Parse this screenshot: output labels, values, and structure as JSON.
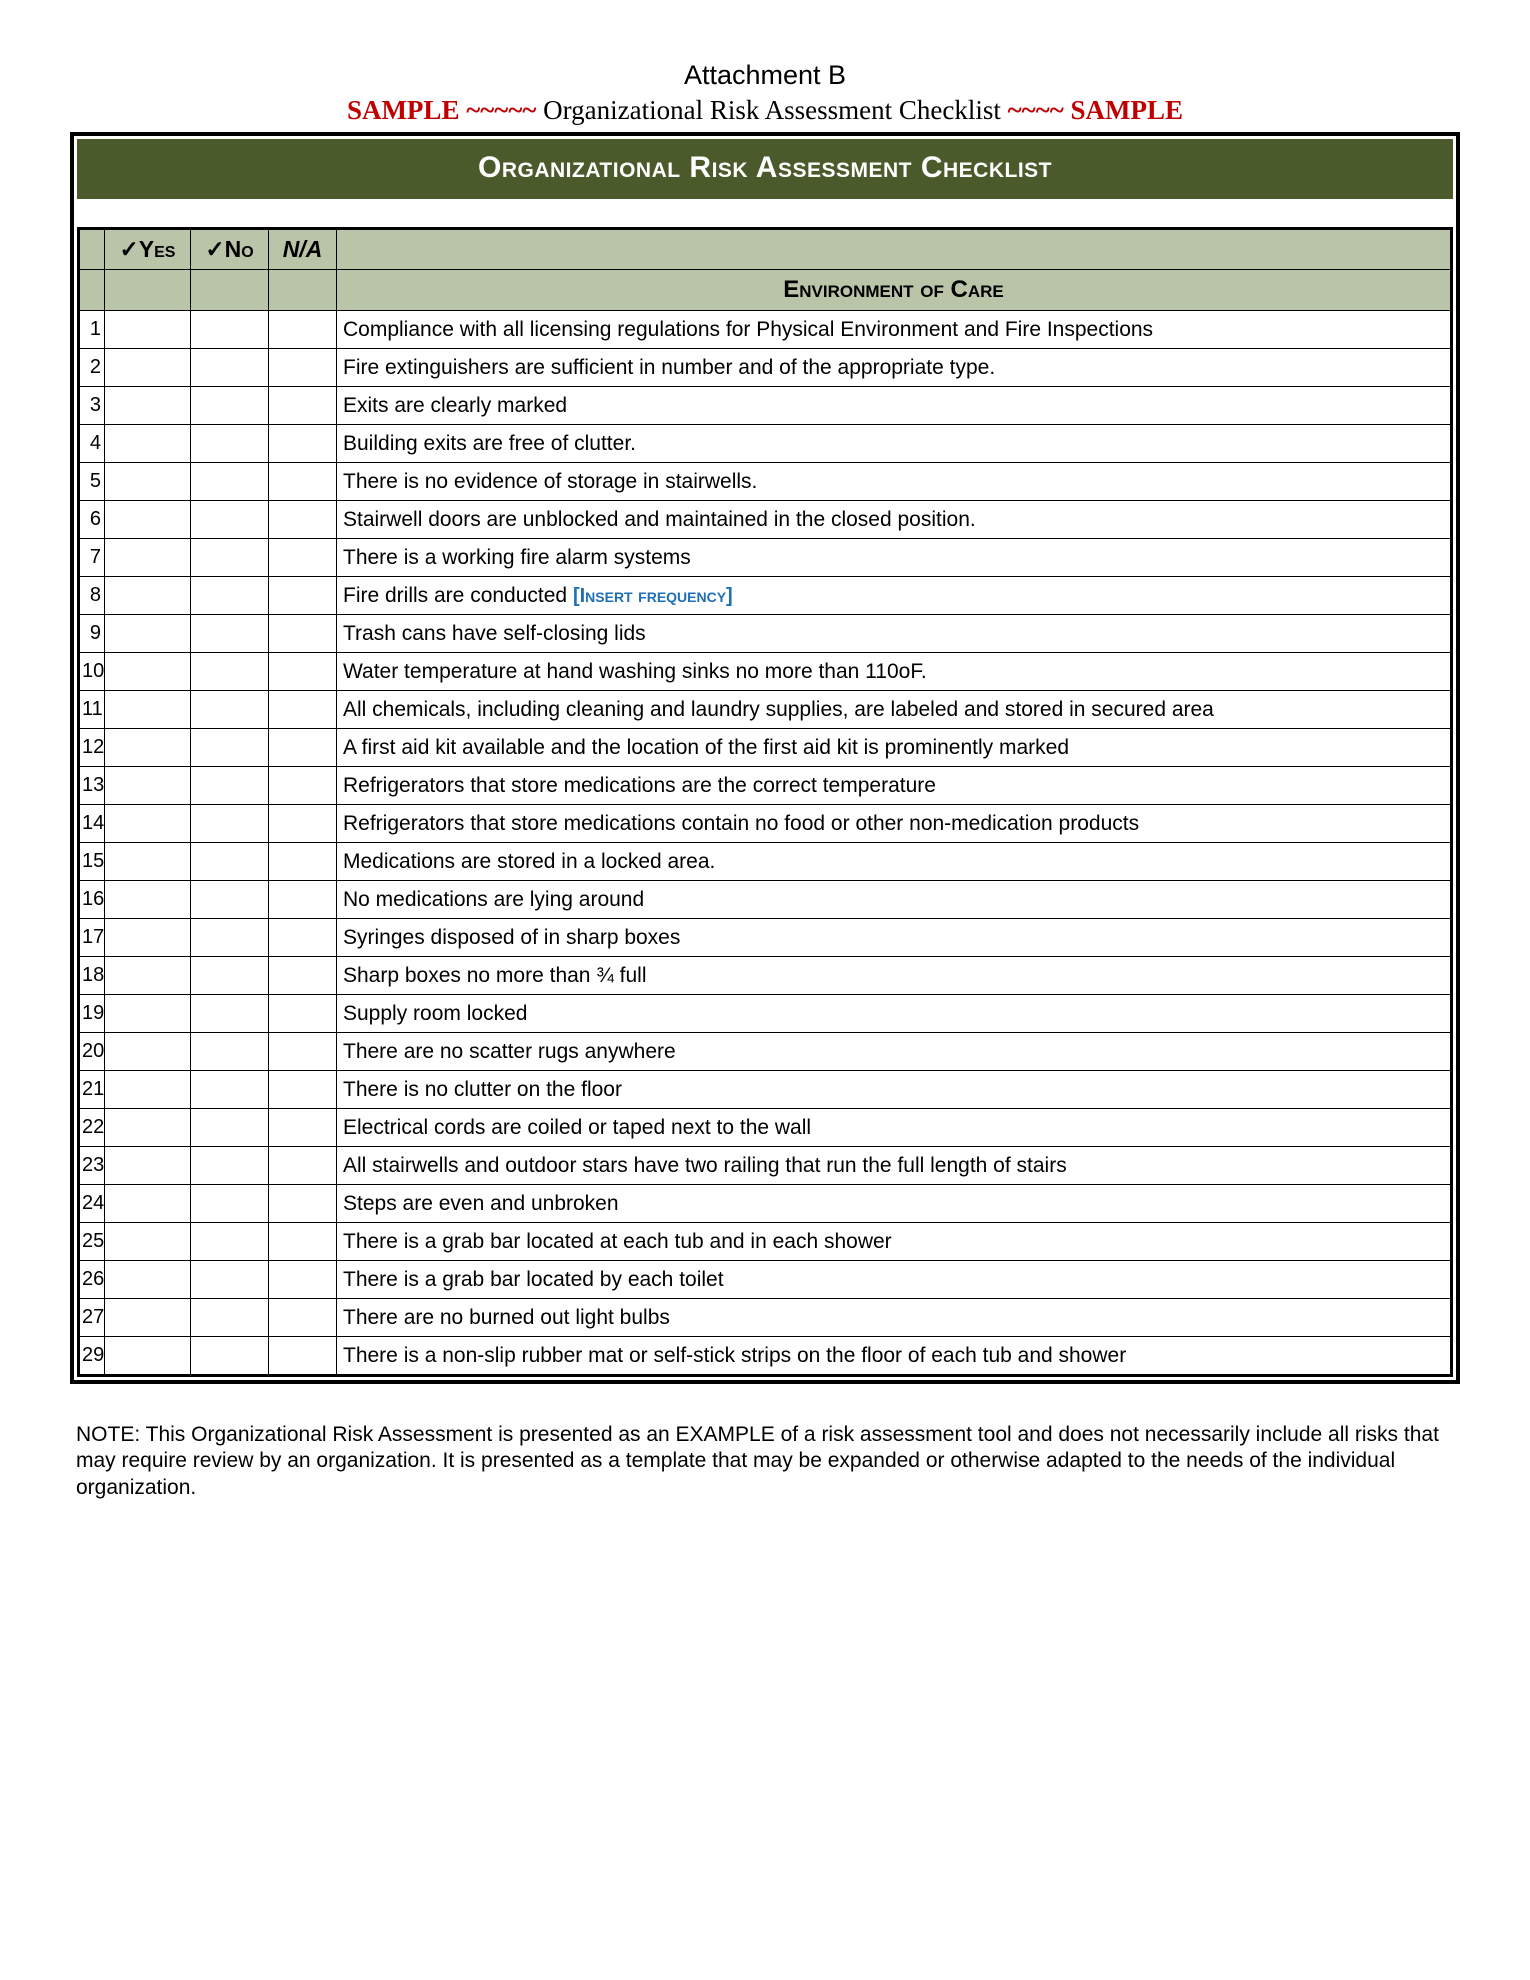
{
  "header": {
    "attachment": "Attachment B",
    "sample_left": "SAMPLE ~~~~~ ",
    "sample_mid": "Organizational Risk Assessment Checklist",
    "sample_right": " ~~~~ SAMPLE",
    "banner": "Organizational Risk Assessment Checklist"
  },
  "columns": {
    "yes": "✓Yes",
    "no": "✓No",
    "na": "N/A"
  },
  "section_title": "Environment of Care",
  "items": [
    {
      "n": "1",
      "text": "Compliance with all licensing regulations for Physical Environment and Fire Inspections"
    },
    {
      "n": "2",
      "text": "Fire extinguishers are sufficient in number and of the appropriate type."
    },
    {
      "n": "3",
      "text": "Exits are clearly marked"
    },
    {
      "n": "4",
      "text": "Building exits are free of clutter."
    },
    {
      "n": "5",
      "text": "There is no evidence of storage in stairwells."
    },
    {
      "n": "6",
      "text": "Stairwell doors are unblocked and maintained in the closed position."
    },
    {
      "n": "7",
      "text": "There is a working fire alarm systems"
    },
    {
      "n": "8",
      "text": "Fire drills are conducted ",
      "insert": "[Insert frequency]"
    },
    {
      "n": "9",
      "text": "Trash cans have self-closing lids"
    },
    {
      "n": "10",
      "text": "Water temperature at hand washing sinks no more than 110oF."
    },
    {
      "n": "11",
      "text": "All chemicals, including cleaning and laundry supplies, are labeled and stored in secured area"
    },
    {
      "n": "12",
      "text": "A first aid kit available and the location of the first aid kit is prominently marked"
    },
    {
      "n": "13",
      "text": "Refrigerators that store medications are the correct temperature"
    },
    {
      "n": "14",
      "text": "Refrigerators that store medications contain no food or other non-medication products"
    },
    {
      "n": "15",
      "text": "Medications are stored in a locked area."
    },
    {
      "n": "16",
      "text": "No medications are lying around"
    },
    {
      "n": "17",
      "text": "Syringes disposed of in sharp boxes"
    },
    {
      "n": "18",
      "text": "Sharp boxes no more than ¾ full"
    },
    {
      "n": "19",
      "text": "Supply room locked"
    },
    {
      "n": "20",
      "text": "There are no scatter rugs anywhere"
    },
    {
      "n": "21",
      "text": "There is no clutter on the floor"
    },
    {
      "n": "22",
      "text": "Electrical cords are coiled or taped next to the wall"
    },
    {
      "n": "23",
      "text": "All stairwells and outdoor stars have two railing that run the full length of stairs"
    },
    {
      "n": "24",
      "text": "Steps are even and unbroken"
    },
    {
      "n": "25",
      "text": "There is a grab bar located at each tub and in each shower"
    },
    {
      "n": "26",
      "text": "There is a grab bar located by each toilet"
    },
    {
      "n": "27",
      "text": "There are no burned out light bulbs"
    },
    {
      "n": "29",
      "text": "There is a non-slip rubber mat or self-stick strips on the floor of each tub and shower"
    }
  ],
  "note": "NOTE: This Organizational Risk Assessment is presented as an EXAMPLE of a risk assessment tool and does not necessarily include all risks that may require review by an organization. It is presented as a template that may be expanded or otherwise adapted to the needs of the individual organization."
}
